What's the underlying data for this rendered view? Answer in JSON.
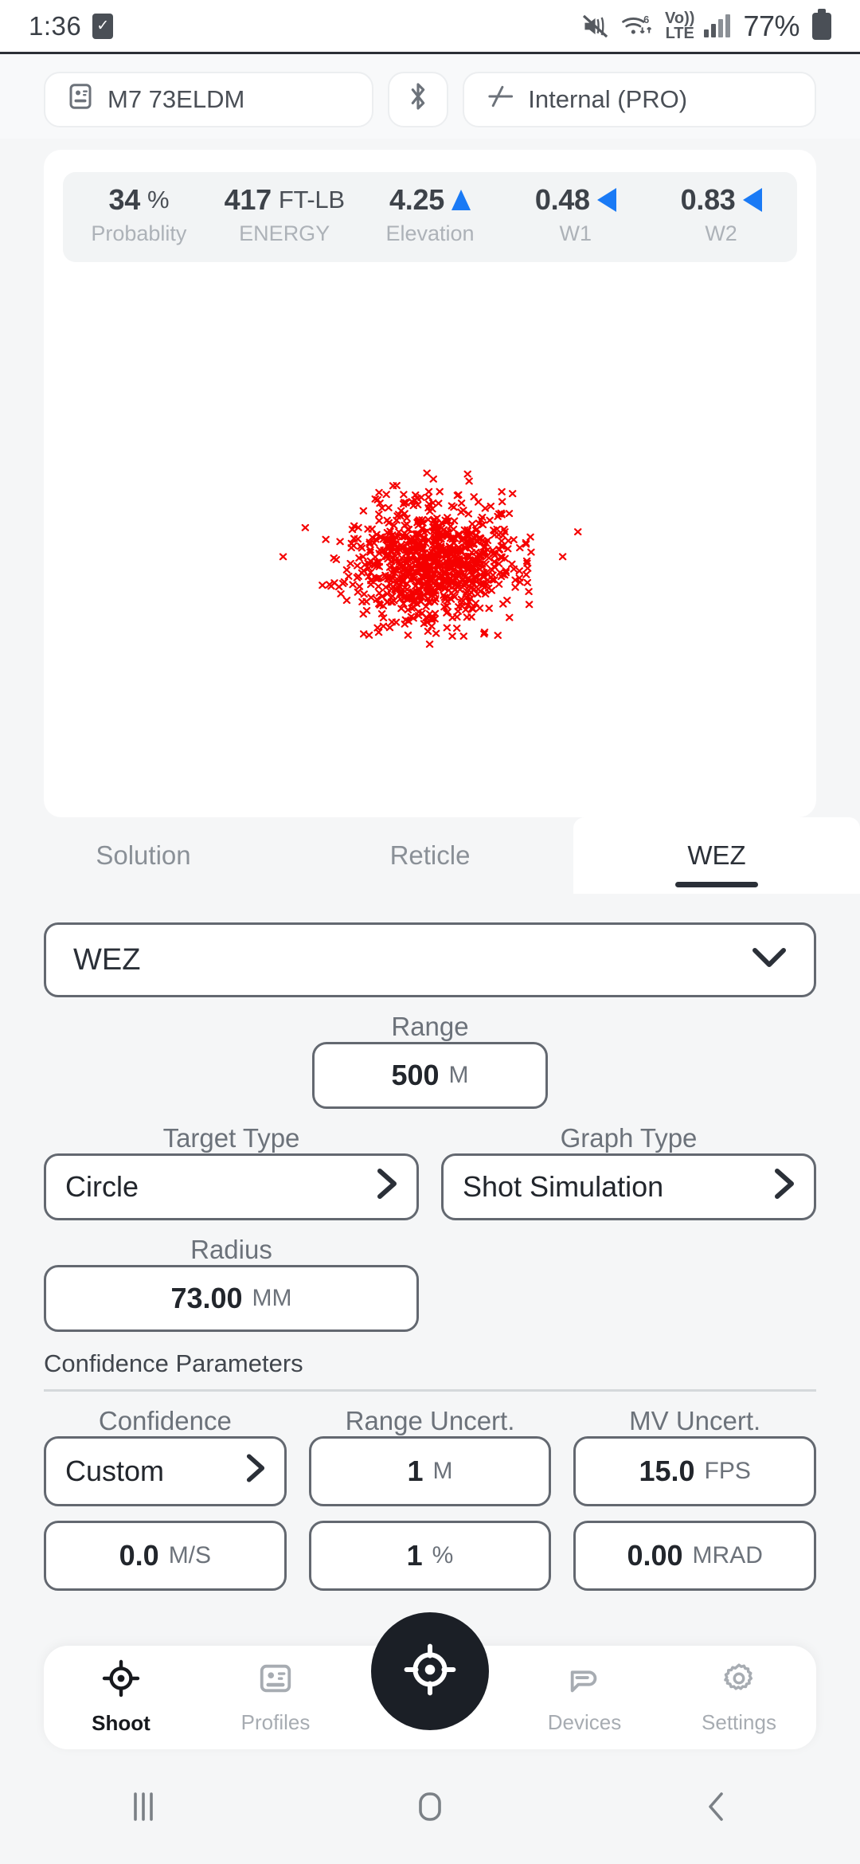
{
  "status_bar": {
    "time": "1:36",
    "check_icon": "checkbox-icon",
    "mute_icon": "mute-icon",
    "wifi_icon": "wifi-6-icon",
    "wifi_gen": "6",
    "volte_line1": "Vo))",
    "volte_line2": "LTE",
    "signal_icon": "cellular-signal-icon",
    "battery_pct": "77%",
    "battery_icon": "battery-icon"
  },
  "top_bar": {
    "profile_icon": "id-card-icon",
    "profile_label": "M7 73ELDM",
    "bluetooth_icon": "bluetooth-icon",
    "device_icon": "rifle-icon",
    "device_label": "Internal (PRO)"
  },
  "stats": [
    {
      "value": "34",
      "unit": "%",
      "label": "Probablity",
      "indicator": "none"
    },
    {
      "value": "417",
      "unit": "FT-LB",
      "label": "ENERGY",
      "indicator": "none"
    },
    {
      "value": "4.25",
      "unit": "",
      "label": "Elevation",
      "indicator": "up"
    },
    {
      "value": "0.48",
      "unit": "",
      "label": "W1",
      "indicator": "left"
    },
    {
      "value": "0.83",
      "unit": "",
      "label": "W2",
      "indicator": "left"
    }
  ],
  "chart_data": {
    "type": "scatter",
    "title": "",
    "xlabel": "",
    "ylabel": "",
    "marker": "x",
    "marker_color": "#f50000",
    "series_name": "Shot Simulation",
    "n_points": 900,
    "center_x": 0.5,
    "center_y": 0.5,
    "spread_x": 0.055,
    "spread_y": 0.06,
    "grid": false,
    "legend": "none",
    "axes_visible": false,
    "target_radius_mm": 73.0,
    "range_m": 500
  },
  "tabs": [
    {
      "label": "Solution",
      "active": false
    },
    {
      "label": "Reticle",
      "active": false
    },
    {
      "label": "WEZ",
      "active": true
    }
  ],
  "wez_select": {
    "value": "WEZ",
    "chevron_icon": "chevron-down-icon"
  },
  "form": {
    "range": {
      "label": "Range",
      "value": "500",
      "unit": "M"
    },
    "target_type": {
      "label": "Target Type",
      "value": "Circle",
      "chevron_icon": "chevron-right-icon"
    },
    "graph_type": {
      "label": "Graph Type",
      "value": "Shot Simulation",
      "chevron_icon": "chevron-right-icon"
    },
    "radius": {
      "label": "Radius",
      "value": "73.00",
      "unit": "MM"
    },
    "confidence_params_title": "Confidence Parameters",
    "confidence": {
      "label": "Confidence",
      "value": "Custom",
      "chevron_icon": "chevron-right-icon"
    },
    "range_uncert": {
      "label": "Range Uncert.",
      "value": "1",
      "unit": "M"
    },
    "mv_uncert": {
      "label": "MV Uncert.",
      "value": "15.0",
      "unit": "FPS"
    },
    "wind_uncert": {
      "value": "0.0",
      "unit": "M/S"
    },
    "angle_uncert": {
      "value": "1",
      "unit": "%"
    },
    "zero_uncert": {
      "value": "0.00",
      "unit": "MRAD"
    }
  },
  "bottom_nav": {
    "items": [
      {
        "label": "Shoot",
        "icon": "crosshair-icon",
        "active": true
      },
      {
        "label": "Profiles",
        "icon": "id-card-icon",
        "active": false
      },
      {
        "label": "Devices",
        "icon": "device-icon",
        "active": false
      },
      {
        "label": "Settings",
        "icon": "gear-icon",
        "active": false
      }
    ],
    "fab_icon": "crosshair-icon"
  },
  "android_nav": {
    "recents_icon": "recents-icon",
    "home_icon": "home-icon",
    "back_icon": "back-icon"
  },
  "colors": {
    "accent_blue": "#1a7af5",
    "scatter_red": "#f50000",
    "dark": "#1b1f26",
    "page_bg": "#f5f6f7"
  }
}
